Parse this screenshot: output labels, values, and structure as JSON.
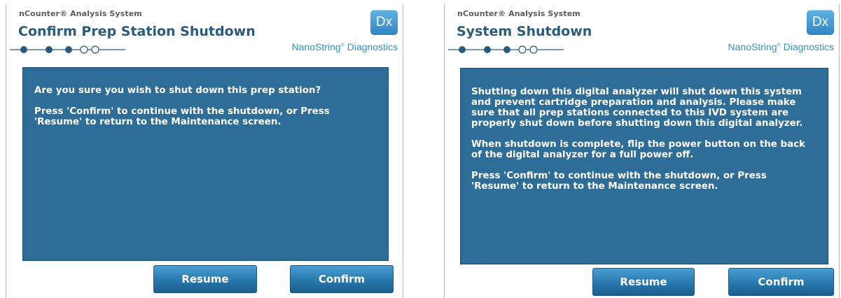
{
  "screens": [
    {
      "app_name": "nCounter® Analysis System",
      "title": "Confirm Prep Station Shutdown",
      "logo_text": "Dx",
      "brand": "NanoString",
      "brand_suffix": "Diagnostics",
      "message": [
        "Are you sure you wish to shut down this prep station?",
        "Press 'Confirm' to continue with the shutdown, or Press 'Resume' to return to the Maintenance screen."
      ],
      "buttons": {
        "resume": "Resume",
        "confirm": "Confirm"
      }
    },
    {
      "app_name": "nCounter® Analysis System",
      "title": "System Shutdown",
      "logo_text": "Dx",
      "brand": "NanoString",
      "brand_suffix": "Diagnostics",
      "message": [
        "Shutting down this digital analyzer will shut down this system and prevent cartridge preparation and analysis. Please make sure that all prep stations connected to this IVD system are properly shut down before shutting down this digital analyzer.",
        "When shutdown is complete, flip the power button on the back of the digital analyzer for a full power off.",
        "Press 'Confirm' to continue with the shutdown, or Press 'Resume' to return to the Maintenance screen."
      ],
      "buttons": {
        "resume": "Resume",
        "confirm": "Confirm"
      }
    }
  ],
  "colors": {
    "panel": "#2e6d97",
    "title": "#2b5a7d",
    "brand": "#2e96c8",
    "button": "#2777ad"
  }
}
